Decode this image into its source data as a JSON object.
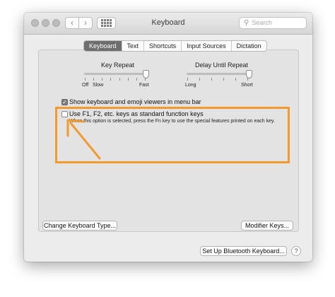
{
  "window": {
    "title": "Keyboard",
    "search_placeholder": "Search",
    "nav_back": "‹",
    "nav_forward": "›"
  },
  "tabs": [
    {
      "label": "Keyboard",
      "active": true
    },
    {
      "label": "Text",
      "active": false
    },
    {
      "label": "Shortcuts",
      "active": false
    },
    {
      "label": "Input Sources",
      "active": false
    },
    {
      "label": "Dictation",
      "active": false
    }
  ],
  "key_repeat": {
    "label": "Key Repeat",
    "left_labels": [
      "Off",
      "Slow"
    ],
    "right_label": "Fast",
    "level": 1.0
  },
  "delay_until_repeat": {
    "label": "Delay Until Repeat",
    "left_label": "Long",
    "right_label": "Short",
    "level": 1.0
  },
  "options": {
    "show_viewers": {
      "label": "Show keyboard and emoji viewers in menu bar",
      "checked": true
    },
    "use_fn_keys": {
      "label": "Use F1, F2, etc. keys as standard function keys",
      "checked": false,
      "note": "When this option is selected, press the Fn key to use the special features printed on each key."
    }
  },
  "buttons": {
    "change_type": "Change Keyboard Type...",
    "modifier_keys": "Modifier Keys...",
    "bluetooth": "Set Up Bluetooth Keyboard...",
    "help": "?"
  },
  "colors": {
    "highlight": "#f39a2e",
    "active_tab": "#6e6e6e"
  }
}
